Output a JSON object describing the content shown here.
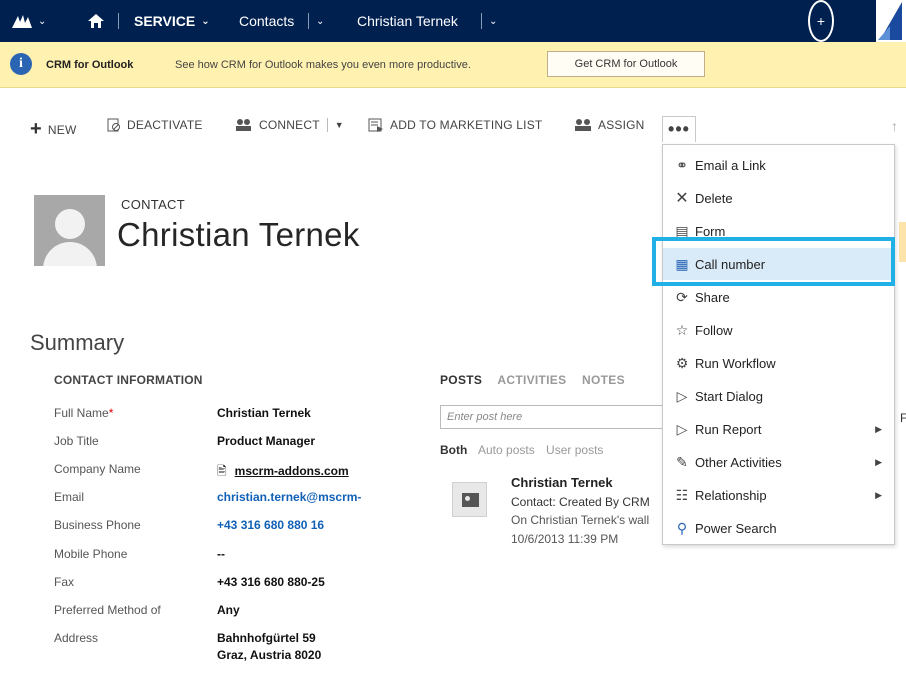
{
  "nav": {
    "service": "SERVICE",
    "contacts": "Contacts",
    "record": "Christian Ternek"
  },
  "notification": {
    "title": "CRM for Outlook",
    "message": "See how CRM for Outlook makes you even more productive.",
    "button": "Get CRM for Outlook"
  },
  "commands": {
    "new": "NEW",
    "deactivate": "DEACTIVATE",
    "connect": "CONNECT",
    "add_to_marketing_list": "ADD TO MARKETING LIST",
    "assign": "ASSIGN",
    "more": "•••"
  },
  "header": {
    "entity_type": "CONTACT",
    "name": "Christian Ternek"
  },
  "summary": {
    "title": "Summary",
    "section": "CONTACT INFORMATION",
    "fields": [
      {
        "label": "Full Name",
        "value": "Christian Ternek"
      },
      {
        "label": "Job Title",
        "value": "Product Manager"
      },
      {
        "label": "Company Name",
        "value": "mscrm-addons.com"
      },
      {
        "label": "Email",
        "value": "christian.ternek@mscrm-"
      },
      {
        "label": "Business Phone",
        "value": "+43 316 680 880 16"
      },
      {
        "label": "Mobile Phone",
        "value": "--"
      },
      {
        "label": "Fax",
        "value": "+43 316 680 880-25"
      },
      {
        "label": "Preferred Method of",
        "value": "Any"
      },
      {
        "label": "Address",
        "value_line1": "Bahnhofgürtel 59",
        "value_line2": "Graz, Austria 8020"
      }
    ]
  },
  "posts": {
    "tabs": [
      "POSTS",
      "ACTIVITIES",
      "NOTES"
    ],
    "placeholder": "Enter post here",
    "filters": [
      "Both",
      "Auto posts",
      "User posts"
    ],
    "author": "Christian Ternek",
    "text": "Contact: Created By CRM",
    "sub": "On Christian Ternek's wall",
    "time": "10/6/2013 11:39 PM"
  },
  "menu": {
    "items": [
      {
        "label": "Email a Link",
        "icon": "link-icon"
      },
      {
        "label": "Delete",
        "icon": "close-icon"
      },
      {
        "label": "Form",
        "icon": "form-icon"
      },
      {
        "label": "Call number",
        "icon": "call-number-icon"
      },
      {
        "label": "Share",
        "icon": "share-icon"
      },
      {
        "label": "Follow",
        "icon": "star-icon"
      },
      {
        "label": "Run Workflow",
        "icon": "workflow-icon"
      },
      {
        "label": "Start Dialog",
        "icon": "dialog-icon"
      },
      {
        "label": "Run Report",
        "icon": "report-icon"
      },
      {
        "label": "Other Activities",
        "icon": "activities-icon"
      },
      {
        "label": "Relationship",
        "icon": "relationship-icon"
      },
      {
        "label": "Power Search",
        "icon": "power-search-icon"
      }
    ]
  },
  "colors": {
    "navbar": "#002050",
    "notification": "#fff1b0",
    "highlight": "#20b0e6",
    "link": "#1160b7"
  }
}
